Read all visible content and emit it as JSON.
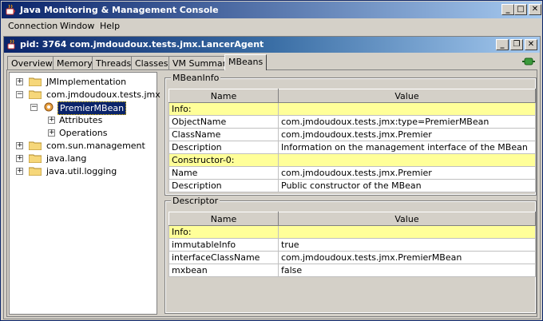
{
  "window": {
    "title": "Java Monitoring & Management Console"
  },
  "menu": {
    "items": [
      "Connection",
      "Window",
      "Help"
    ]
  },
  "inner_window": {
    "title": "pid: 3764 com.jmdoudoux.tests.jmx.LancerAgent"
  },
  "tabs": [
    "Overview",
    "Memory",
    "Threads",
    "Classes",
    "VM Summary",
    "MBeans"
  ],
  "tree": {
    "jmimpl": "JMImplementation",
    "jmdoudoux": "com.jmdoudoux.tests.jmx",
    "premier": "PremierMBean",
    "attributes": "Attributes",
    "operations": "Operations",
    "sun": "com.sun.management",
    "lang": "java.lang",
    "logging": "java.util.logging"
  },
  "mbeaninfo": {
    "group_label": "MBeanInfo",
    "col_name": "Name",
    "col_value": "Value",
    "rows": [
      {
        "name": "Info:",
        "value": "",
        "highlight": true
      },
      {
        "name": "ObjectName",
        "value": "com.jmdoudoux.tests.jmx:type=PremierMBean"
      },
      {
        "name": "ClassName",
        "value": "com.jmdoudoux.tests.jmx.Premier"
      },
      {
        "name": "Description",
        "value": "Information on the management interface of the MBean"
      },
      {
        "name": "Constructor-0:",
        "value": "",
        "highlight": true
      },
      {
        "name": "Name",
        "value": "com.jmdoudoux.tests.jmx.Premier"
      },
      {
        "name": "Description",
        "value": "Public constructor of the MBean"
      }
    ]
  },
  "descriptor": {
    "group_label": "Descriptor",
    "col_name": "Name",
    "col_value": "Value",
    "rows": [
      {
        "name": "Info:",
        "value": "",
        "highlight": true
      },
      {
        "name": "immutableInfo",
        "value": "true"
      },
      {
        "name": "interfaceClassName",
        "value": "com.jmdoudoux.tests.jmx.PremierMBean"
      },
      {
        "name": "mxbean",
        "value": "false"
      }
    ]
  },
  "colors": {
    "highlight_row": "#ffff99",
    "titlebar": "#0a246a",
    "selection": "#0a246a"
  }
}
